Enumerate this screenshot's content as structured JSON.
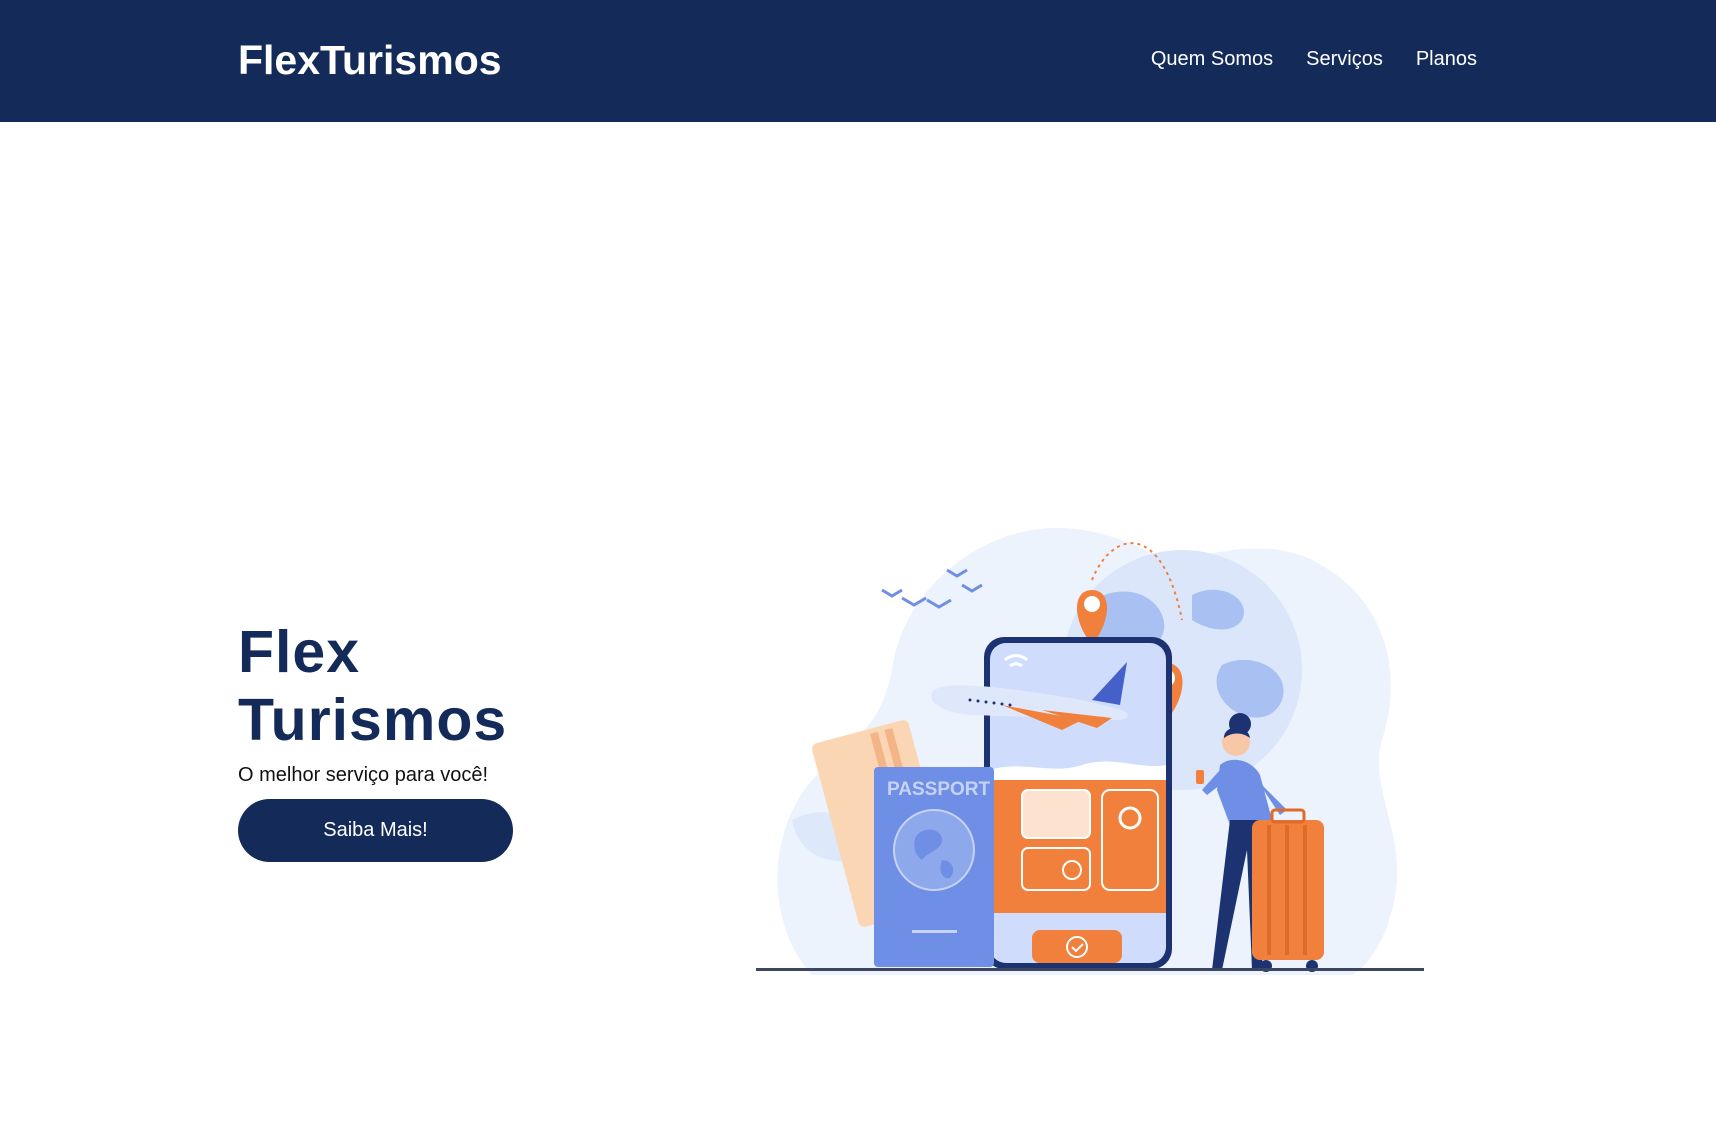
{
  "header": {
    "brand": "FlexTurismos",
    "nav": [
      {
        "label": "Quem Somos"
      },
      {
        "label": "Serviços"
      },
      {
        "label": "Planos"
      }
    ]
  },
  "hero": {
    "title_line1": "Flex",
    "title_line2": "Turismos",
    "subtitle": "O melhor serviço para você!",
    "button_label": "Saiba Mais!",
    "illustration": {
      "passport_label": "PASSPORT",
      "icons": [
        "airplane-icon",
        "passport-icon",
        "location-pin-icon",
        "luggage-icon",
        "wifi-icon",
        "check-icon",
        "clock-icon",
        "ticket-icon"
      ]
    }
  },
  "colors": {
    "primary": "#142b5a",
    "accent": "#f0803c",
    "illustration_blue": "#6f8fe6",
    "illustration_light": "#e7eefb"
  }
}
